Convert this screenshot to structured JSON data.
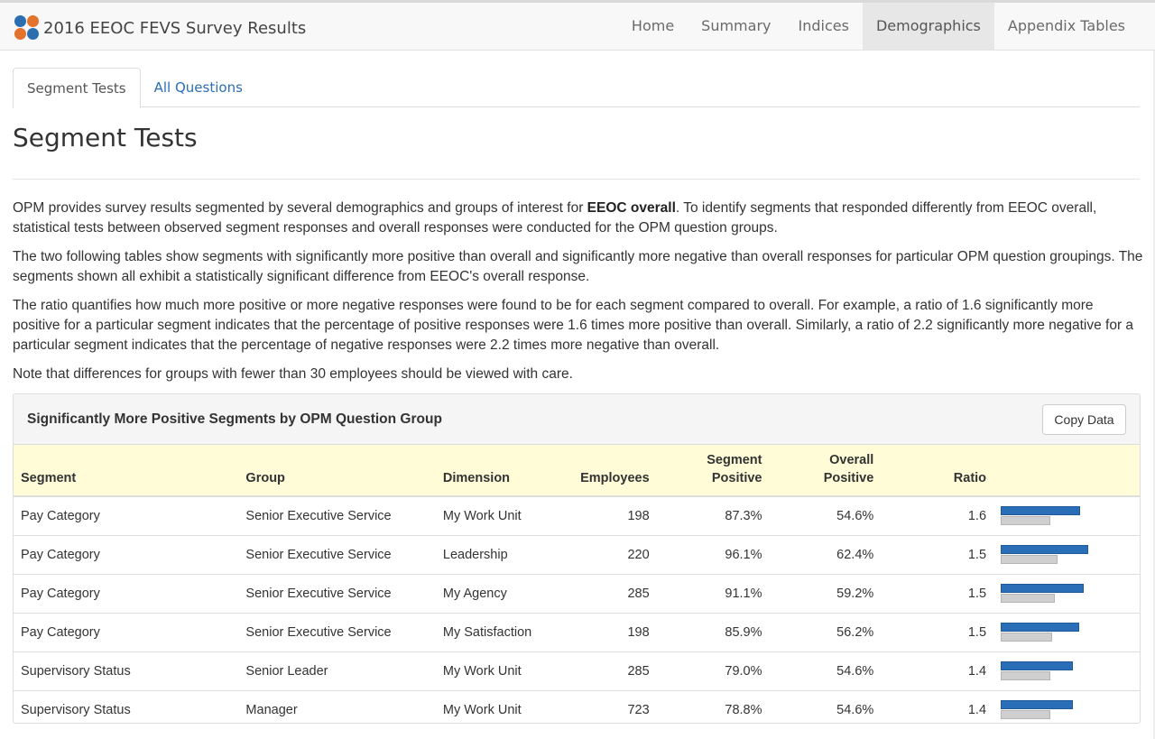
{
  "app": {
    "title": "2016 EEOC FEVS Survey Results",
    "nav": [
      "Home",
      "Summary",
      "Indices",
      "Demographics",
      "Appendix Tables"
    ],
    "nav_active": "Demographics"
  },
  "tabs": [
    {
      "label": "Segment Tests",
      "active": true
    },
    {
      "label": "All Questions",
      "active": false
    }
  ],
  "page_title": "Segment Tests",
  "intro": {
    "p1_a": "OPM provides survey results segmented by several demographics and groups of interest for ",
    "p1_bold": "EEOC overall",
    "p1_b": ". To identify segments that responded differently from EEOC overall, statistical tests between observed segment responses and overall responses were conducted for the OPM question groups.",
    "p2": "The two following tables show segments with significantly more positive than overall and significantly more negative than overall responses for particular OPM question groupings. The segments shown all exhibit a statistically significant difference from EEOC's overall response.",
    "p3": "The ratio quantifies how much more positive or more negative responses were found to be for each segment compared to overall. For example, a ratio of 1.6 significantly more positive for a particular segment indicates that the percentage of positive responses were 1.6 times more positive than overall. Similarly, a ratio of 2.2 significantly more negative for a particular segment indicates that the percentage of negative responses were 2.2 times more negative than overall.",
    "p4": "Note that differences for groups with fewer than 30 employees should be viewed with care."
  },
  "panel": {
    "title": "Significantly More Positive Segments by OPM Question Group",
    "copy_label": "Copy Data",
    "columns": {
      "segment": "Segment",
      "group": "Group",
      "dimension": "Dimension",
      "employees": "Employees",
      "segment_positive_1": "Segment",
      "segment_positive_2": "Positive",
      "overall_positive": "Overall Positive",
      "ratio": "Ratio"
    },
    "rows": [
      {
        "segment": "Pay Category",
        "group": "Senior Executive Service",
        "dimension": "My Work Unit",
        "employees": "198",
        "segment_positive": "87.3%",
        "overall_positive": "54.6%",
        "ratio": "1.6",
        "seg_val": 87.3,
        "ov_val": 54.6
      },
      {
        "segment": "Pay Category",
        "group": "Senior Executive Service",
        "dimension": "Leadership",
        "employees": "220",
        "segment_positive": "96.1%",
        "overall_positive": "62.4%",
        "ratio": "1.5",
        "seg_val": 96.1,
        "ov_val": 62.4
      },
      {
        "segment": "Pay Category",
        "group": "Senior Executive Service",
        "dimension": "My Agency",
        "employees": "285",
        "segment_positive": "91.1%",
        "overall_positive": "59.2%",
        "ratio": "1.5",
        "seg_val": 91.1,
        "ov_val": 59.2
      },
      {
        "segment": "Pay Category",
        "group": "Senior Executive Service",
        "dimension": "My Satisfaction",
        "employees": "198",
        "segment_positive": "85.9%",
        "overall_positive": "56.2%",
        "ratio": "1.5",
        "seg_val": 85.9,
        "ov_val": 56.2
      },
      {
        "segment": "Supervisory Status",
        "group": "Senior Leader",
        "dimension": "My Work Unit",
        "employees": "285",
        "segment_positive": "79.0%",
        "overall_positive": "54.6%",
        "ratio": "1.4",
        "seg_val": 79.0,
        "ov_val": 54.6
      },
      {
        "segment": "Supervisory Status",
        "group": "Manager",
        "dimension": "My Work Unit",
        "employees": "723",
        "segment_positive": "78.8%",
        "overall_positive": "54.6%",
        "ratio": "1.4",
        "seg_val": 78.8,
        "ov_val": 54.6
      }
    ]
  },
  "colors": {
    "segment_bar": "#2a6eb8",
    "overall_bar": "#cfcfcf",
    "header_bg": "#fffcd7",
    "link": "#2a6eb4"
  }
}
